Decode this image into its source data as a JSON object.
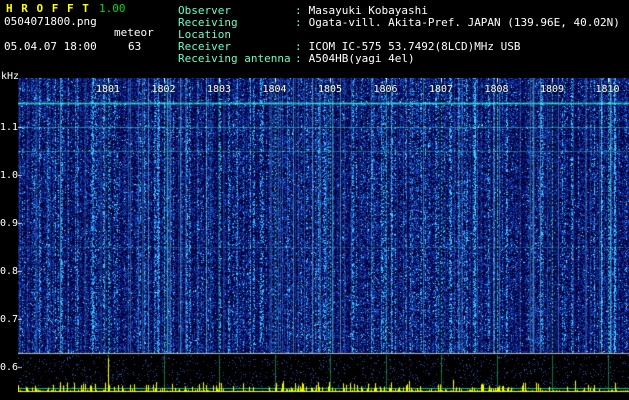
{
  "app": {
    "title": "H R O F F T",
    "version": "1.00",
    "filename": "0504071800.png",
    "mode_label": "meteor",
    "datetime": "05.04.07 18:00",
    "echo_count": "63"
  },
  "info": {
    "colon": ":",
    "rows": [
      {
        "label": "Observer",
        "value": "Masayuki Kobayashi"
      },
      {
        "label": "Receiving Location",
        "value": "Ogata-vill. Akita-Pref. JAPAN (139.96E, 40.02N)"
      },
      {
        "label": "Receiver",
        "value": "ICOM IC-575 53.7492(8LCD)MHz USB"
      },
      {
        "label": "Receiving antenna",
        "value": "A504HB(yagi 4el)"
      }
    ]
  },
  "chart_data": {
    "type": "heatmap",
    "subtype": "radio meteor-echo spectrogram (waterfall) with signal-level strip below",
    "title": "",
    "ylabel": "kHz",
    "y_tick_labels": [
      "1.1",
      "1.0",
      "0.9",
      "0.8",
      "0.7",
      "0.6"
    ],
    "y_range_khz": [
      0.6,
      1.2
    ],
    "x_tick_labels": [
      "1801",
      "1802",
      "1803",
      "1804",
      "1805",
      "1806",
      "1807",
      "1808",
      "1809",
      "1810"
    ],
    "x_axis": "time of day HHMM, one tick per minute, 18:01-18:10",
    "grid": "vertical dashed green line at each minute tick",
    "noise": "dense blue random noise over whole spectrogram with many brighter vertical interference streaks",
    "carrier_lines": [
      {
        "khz": 1.15,
        "strength": "strong"
      },
      {
        "khz": 1.1,
        "strength": "medium"
      },
      {
        "khz": 1.05,
        "strength": "medium-weak"
      },
      {
        "khz": 0.85,
        "strength": "faint"
      }
    ],
    "level_strip": {
      "description": "long-term signal level vs time, yellow spikes on black, occasional tall meteor-echo spikes, horizontal green baseline",
      "legend": "none"
    }
  },
  "colors": {
    "background": "#000000",
    "title": "#ffff00",
    "version": "#00dd00",
    "info_label": "#66ffcc",
    "text": "#ffffff",
    "minute_grid": "#28ff96",
    "carrier": "#3cffeb",
    "separator": "#b8b8b8",
    "spike": "#ffff00",
    "baseline": "#00dc78",
    "noise_bright": "#5aaaff"
  }
}
